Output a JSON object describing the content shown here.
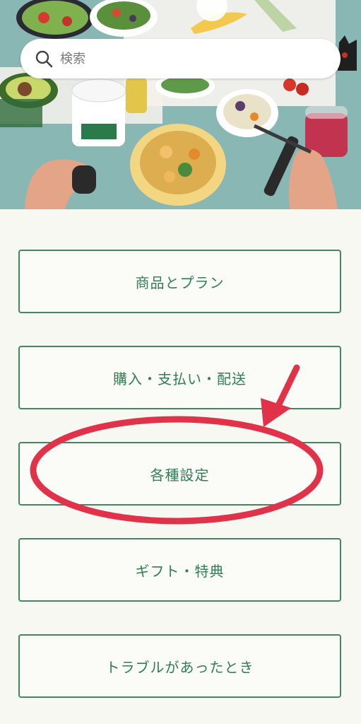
{
  "search": {
    "placeholder": "検索"
  },
  "menu": {
    "items": [
      {
        "label": "商品とプラン"
      },
      {
        "label": "購入・支払い・配送"
      },
      {
        "label": "各種設定"
      },
      {
        "label": "ギフト・特典"
      },
      {
        "label": "トラブルがあったとき"
      }
    ]
  },
  "colors": {
    "accent_green": "#3c8a5e",
    "annotation_red": "#e0334a",
    "page_background": "#f8f8f3"
  },
  "annotation": {
    "highlighted_item": "各種設定"
  }
}
